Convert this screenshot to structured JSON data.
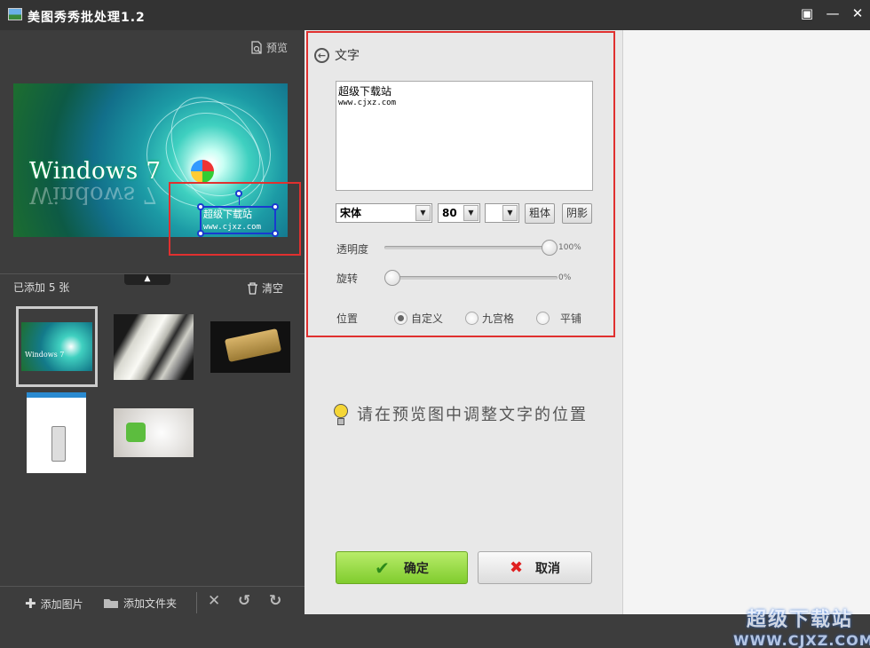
{
  "app": {
    "title": "美图秀秀批处理1.2"
  },
  "window_controls": {
    "feedback": "▣",
    "minimize": "—",
    "close": "✕"
  },
  "preview": {
    "link_label": "预览",
    "image_text": "Windows 7",
    "overlay_line1": "超级下载站",
    "overlay_line2": "www.cjxz.com"
  },
  "list": {
    "added_label": "已添加 5 张",
    "clear_label": "清空",
    "thumb1_text": "Windows 7"
  },
  "bottom": {
    "add_image": "添加图片",
    "add_folder": "添加文件夹"
  },
  "panel": {
    "back_label": "文字",
    "text_line1": "超级下载站",
    "text_line2": "www.cjxz.com",
    "font": "宋体",
    "size": "80",
    "bold_label": "粗体",
    "shadow_label": "阴影",
    "opacity_label": "透明度",
    "opacity_value": "100%",
    "opacity_level": 100,
    "rotate_label": "旋转",
    "rotate_value": "0%",
    "rotate_level": 0,
    "position_label": "位置",
    "position_options": [
      "自定义",
      "九宫格",
      "平铺"
    ],
    "position_selected": "自定义",
    "hint": "请在预览图中调整文字的位置",
    "confirm_label": "确定",
    "cancel_label": "取消"
  },
  "watermark": {
    "line1": "超级下载站",
    "line2": "WWW.CJXZ.COM"
  }
}
